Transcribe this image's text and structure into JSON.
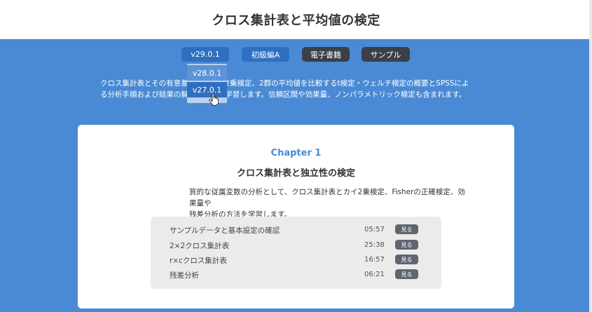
{
  "header": {
    "title": "クロス集計表と平均値の検定"
  },
  "toolbar": {
    "version_label": "v29.0.1",
    "level_label": "初級編A",
    "ebook_label": "電子書籍",
    "sample_label": "サンプル"
  },
  "version_dropdown": {
    "options": [
      "v28.0.1",
      "v27.0.1"
    ],
    "hovered": "v27.0.1"
  },
  "intro": {
    "line1": "クロス集計表とその有意差検定、カイ2乗検定、2群の平均値を比較するt検定・ウェルチ検定の概要とSPSSによ",
    "line2": "る分析手順および結果の解釈について学習します。信頼区間や効果量、ノンパラメトリック検定も含まれます。"
  },
  "chapter": {
    "label": "Chapter 1",
    "title": "クロス集計表と独立性の検定",
    "desc_line1": "質的な従属変数の分析として、クロス集計表とカイ2乗検定、Fisherの正確検定、効果量や",
    "desc_line2": "残差分析の方法を学習します。",
    "lessons": [
      {
        "title": "サンプルデータと基本設定の確認",
        "time": "05:57",
        "button": "見る"
      },
      {
        "title": "2×2クロス集計表",
        "time": "25:38",
        "button": "見る"
      },
      {
        "title": "r×cクロス集計表",
        "time": "16:57",
        "button": "見る"
      },
      {
        "title": "残差分析",
        "time": "06:21",
        "button": "見る"
      }
    ]
  },
  "colors": {
    "background": "#4a8ad4",
    "accent_blue": "#2f6fc0",
    "dark_button": "#3b3f47",
    "watch_button": "#5f6670"
  },
  "icons": {
    "cursor": "hand-pointer-icon"
  }
}
